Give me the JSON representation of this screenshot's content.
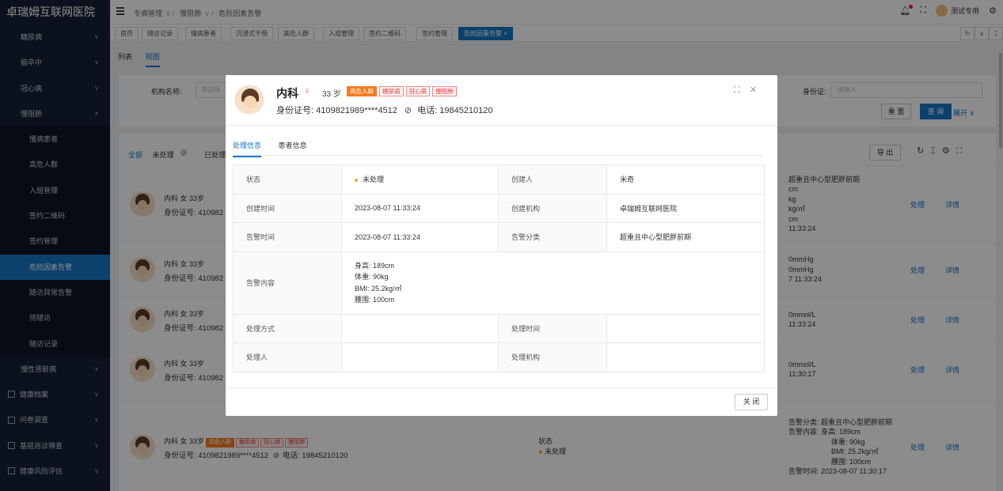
{
  "app": {
    "title": "卓瑞姆互联网医院"
  },
  "sidebar": {
    "items": [
      {
        "label": "糖尿病",
        "kind": "top"
      },
      {
        "label": "脑卒中",
        "kind": "top"
      },
      {
        "label": "冠心病",
        "kind": "top"
      },
      {
        "label": "慢阻肺",
        "kind": "top-open"
      },
      {
        "label": "慢病患者",
        "kind": "sub"
      },
      {
        "label": "高危人群",
        "kind": "sub"
      },
      {
        "label": "入组管理",
        "kind": "sub"
      },
      {
        "label": "签约二维码",
        "kind": "sub"
      },
      {
        "label": "签约管理",
        "kind": "sub"
      },
      {
        "label": "危险因素告警",
        "kind": "sub-active"
      },
      {
        "label": "随访异常告警",
        "kind": "sub"
      },
      {
        "label": "待随访",
        "kind": "sub"
      },
      {
        "label": "随访记录",
        "kind": "sub"
      },
      {
        "label": "慢性肾脏病",
        "kind": "top"
      },
      {
        "label": "健康档案",
        "kind": "icon"
      },
      {
        "label": "问卷调查",
        "kind": "icon"
      },
      {
        "label": "基层巡诊筛查",
        "kind": "icon"
      },
      {
        "label": "健康风险评估",
        "kind": "icon"
      }
    ]
  },
  "header": {
    "breadcrumb": [
      "专病管理",
      "慢阻肺",
      "危险因素告警"
    ],
    "user": "测试专用"
  },
  "tabs": [
    "首页",
    "随访记录",
    "慢病患者",
    "沉浸式干预",
    "高危人群",
    "入组管理",
    "签约二维码",
    "签约管理",
    "危险因素告警"
  ],
  "view_switch": [
    "列表",
    "视图"
  ],
  "filter": {
    "org_label": "机构名称:",
    "org_placeholder": "请选择",
    "id_label": "身份证:",
    "id_placeholder": "请输入",
    "reset": "重 置",
    "query": "查 询",
    "expand": "展开"
  },
  "list": {
    "status_tabs": [
      "全部",
      "未处理",
      "已处理"
    ],
    "unprocessed_badge": "0",
    "export": "导 出",
    "rows": [
      {
        "name": "内科 女 33岁",
        "id": "身份证号: 410982",
        "alert": [
          "超重且中心型肥胖前期",
          "cm",
          "kg",
          "kg/㎡",
          "cm",
          "11:33:24"
        ],
        "op1": "处理",
        "op2": "详情"
      },
      {
        "name": "内科 女 33岁",
        "id": "身份证号: 410982",
        "alert": [
          "0mmHg",
          "0mmHg",
          "7 11:33:24"
        ],
        "op1": "处理",
        "op2": "详情"
      },
      {
        "name": "内科 女 33岁",
        "id": "身份证号: 410982",
        "alert": [
          "0mmol/L",
          "11:33:24"
        ],
        "op1": "处理",
        "op2": "详情"
      },
      {
        "name": "内科 女 33岁",
        "id": "身份证号: 410982",
        "alert": [
          "0mmol/L",
          "11:30:17"
        ],
        "op1": "处理",
        "op2": "详情"
      },
      {
        "name": "内科 女 33岁",
        "id": "身份证号: 4109821989****4512",
        "phone": "电话: 19845210120",
        "tags": [
          "高危人群",
          "糖尿病",
          "冠心病",
          "慢阻肺"
        ],
        "status_label": "状态",
        "status": "未处理",
        "alert": [
          "告警分类: 超重且中心型肥胖前期",
          "告警内容:  身高: 189cm",
          "体重: 90kg",
          "BMI: 25.2kg/㎡",
          "腰围: 100cm",
          "告警时间: 2023-08-07 11:30:17"
        ],
        "op1": "处理",
        "op2": "详情"
      }
    ]
  },
  "modal": {
    "name": "内科",
    "gender_symbol": "♀",
    "age": "33 岁",
    "tags": [
      "高危人群",
      "糖尿病",
      "冠心病",
      "慢阻肺"
    ],
    "id_text": "身份证号: 4109821989****4512",
    "phone": "电话: 19845210120",
    "tabs": [
      "处理信息",
      "患者信息"
    ],
    "fields": {
      "status_k": "状态",
      "status_v": "未处理",
      "creator_k": "创建人",
      "creator_v": "米奇",
      "ctime_k": "创建时间",
      "ctime_v": "2023-08-07 11:33:24",
      "corg_k": "创建机构",
      "corg_v": "卓瑞姆互联网医院",
      "atime_k": "告警时间",
      "atime_v": "2023-08-07 11:33:24",
      "acat_k": "告警分类",
      "acat_v": "超重且中心型肥胖前期",
      "acontent_k": "告警内容",
      "acontent_v": [
        "身高: 189cm",
        "体重: 90kg",
        "BMI: 25.2kg/㎡",
        "腰围: 100cm"
      ],
      "pmethod_k": "处理方式",
      "pmethod_v": "",
      "ptime_k": "处理时间",
      "ptime_v": "",
      "pperson_k": "处理人",
      "pperson_v": "",
      "porg_k": "处理机构",
      "porg_v": ""
    },
    "close": "关 闭"
  },
  "colors": {
    "sidebar": "#142236",
    "accent": "#1677c9",
    "warn": "#f77a1e",
    "danger": "#e23d3d"
  }
}
